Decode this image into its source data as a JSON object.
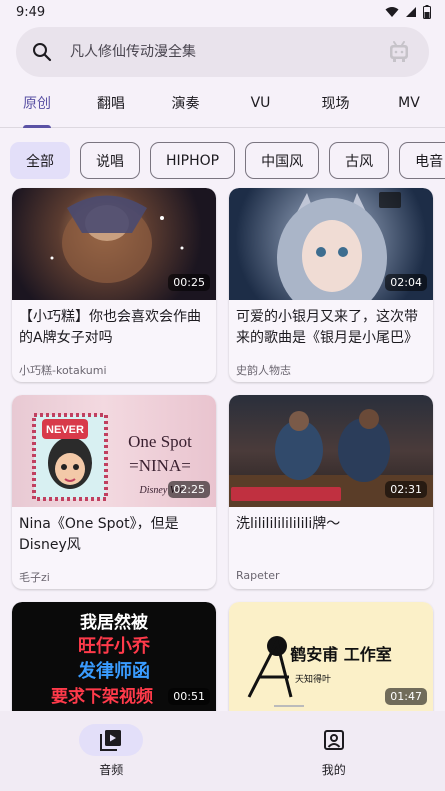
{
  "status": {
    "time": "9:49"
  },
  "search": {
    "placeholder": "凡人修仙传动漫全集"
  },
  "tabs": [
    {
      "label": "原创"
    },
    {
      "label": "翻唱"
    },
    {
      "label": "演奏"
    },
    {
      "label": "VU"
    },
    {
      "label": "现场"
    },
    {
      "label": "MV"
    }
  ],
  "chips": [
    {
      "label": "全部"
    },
    {
      "label": "说唱"
    },
    {
      "label": "HIPHOP"
    },
    {
      "label": "中国风"
    },
    {
      "label": "古风"
    },
    {
      "label": "电音"
    }
  ],
  "cards": [
    {
      "duration": "00:25",
      "title": "【小巧糕】你也会喜欢会作曲的A牌女子对吗",
      "author": "小巧糕-kotakumi"
    },
    {
      "duration": "02:04",
      "title": "可爱的小银月又来了，这次带来的歌曲是《银月是小尾巴》",
      "author": "史韵人物志"
    },
    {
      "duration": "02:25",
      "title": "Nina《One Spot》，但是Disney风",
      "author": "毛子zi",
      "thumb_text": {
        "line1": "One Spot",
        "line2": "=NINA=",
        "line3": "Disney Ver.",
        "badge": "NEVER"
      }
    },
    {
      "duration": "02:31",
      "title": "洗lililililililili牌～",
      "author": "Rapeter"
    },
    {
      "duration": "00:51",
      "title": "",
      "author": "",
      "thumb_text": {
        "line1": "我居然被",
        "line2": "旺仔小乔",
        "line3": "发律师函",
        "line4": "要求下架视频"
      }
    },
    {
      "duration": "01:47",
      "title": "",
      "author": "",
      "thumb_text": {
        "line1": "鹤安甫 工作室",
        "line2": "天知得叶"
      }
    }
  ],
  "nav": [
    {
      "label": "音频"
    },
    {
      "label": "我的"
    }
  ],
  "colors": {
    "accent": "#5b52a5",
    "chip_selected": "#e3dff9",
    "background": "#f6f1f9"
  }
}
